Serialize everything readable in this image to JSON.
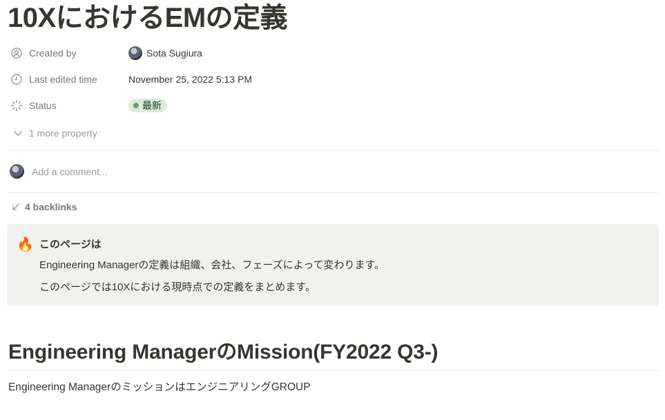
{
  "page": {
    "title": "10XにおけるEMの定義"
  },
  "properties": {
    "created_by": {
      "label": "Created by",
      "value": "Sota Sugiura",
      "icon": "user-circle-icon"
    },
    "last_edited": {
      "label": "Last edited time",
      "value": "November 25, 2022 5:13 PM",
      "icon": "clock-icon"
    },
    "status": {
      "label": "Status",
      "value": "最新",
      "icon": "status-spinner-icon",
      "pill_color": "#dbeddb",
      "dot_color": "#6c9b7d"
    },
    "more": {
      "label": "1 more property",
      "icon": "chevron-down-icon"
    }
  },
  "comment": {
    "placeholder": "Add a comment..."
  },
  "backlinks": {
    "label": "4 backlinks",
    "icon": "arrow-down-left-icon"
  },
  "callout": {
    "icon": "🔥",
    "title": "このページは",
    "lines": [
      "Engineering Managerの定義は組織、会社、フェーズによって変わります。",
      "このページでは10Xにおける現時点での定義をまとめます。"
    ]
  },
  "section": {
    "heading": "Engineering ManagerのMission(FY2022 Q3-)",
    "body": "Engineering ManagerのミッションはエンジニアリングGROUP"
  }
}
